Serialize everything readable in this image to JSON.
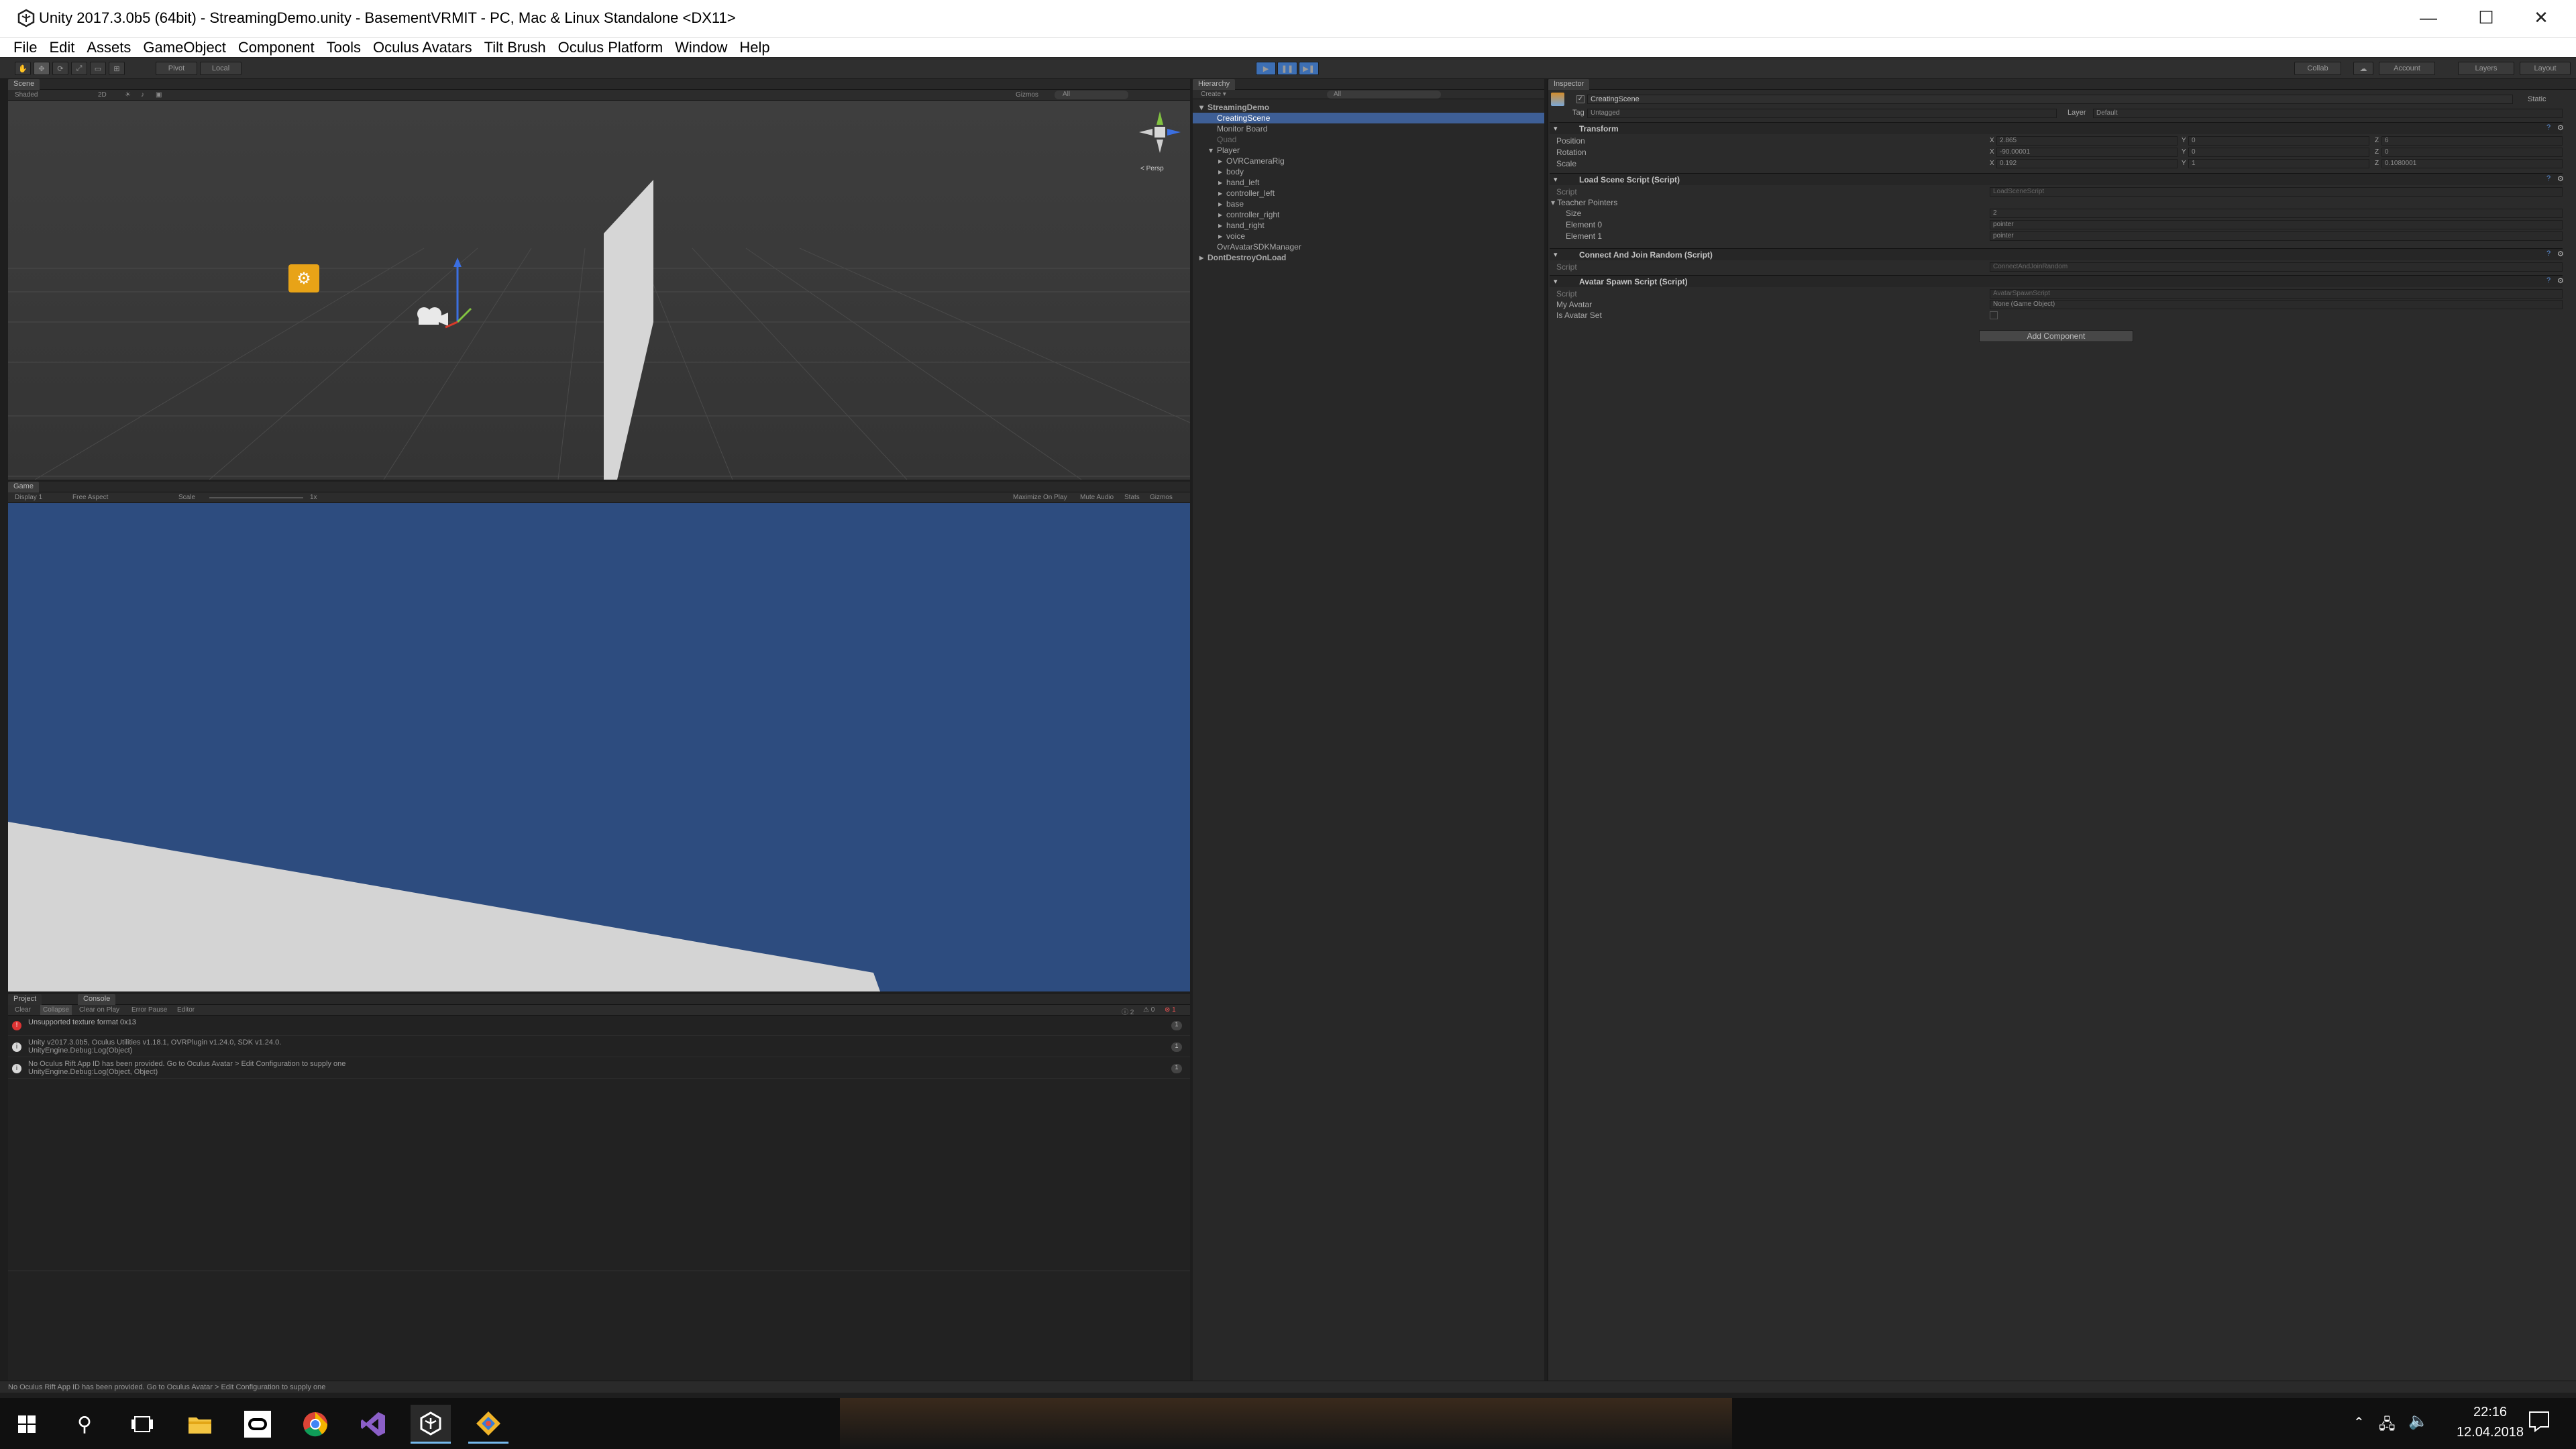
{
  "window": {
    "title": "Unity 2017.3.0b5 (64bit) - StreamingDemo.unity - BasementVRMIT - PC, Mac & Linux Standalone <DX11>",
    "minimize": "—",
    "maximize": "☐",
    "close": "✕"
  },
  "menu": [
    "File",
    "Edit",
    "Assets",
    "GameObject",
    "Component",
    "Tools",
    "Oculus Avatars",
    "Tilt Brush",
    "Oculus Platform",
    "Window",
    "Help"
  ],
  "toolbar": {
    "pivot": "Pivot",
    "local": "Local",
    "collab": "Collab",
    "account": "Account",
    "layers": "Layers",
    "layout": "Layout",
    "play_color": "#3d6fb4"
  },
  "scene": {
    "tab": "Scene",
    "shading": "Shaded",
    "mode_2d": "2D",
    "gizmos": "Gizmos",
    "search": "All",
    "persp": "< Persp",
    "background_color": "#3a3a3a"
  },
  "game": {
    "tab": "Game",
    "display": "Display 1",
    "aspect": "Free Aspect",
    "scale_label": "Scale",
    "scale_value": "1x",
    "maximize": "Maximize On Play",
    "mute": "Mute Audio",
    "stats": "Stats",
    "gizmos": "Gizmos",
    "sky_color": "#2d4c7f"
  },
  "console": {
    "tab_project": "Project",
    "tab_console": "Console",
    "buttons": [
      "Clear",
      "Collapse",
      "Clear on Play",
      "Error Pause",
      "Editor"
    ],
    "counts": {
      "info": "2",
      "warn": "0",
      "error": "1"
    },
    "entries": [
      {
        "type": "error",
        "line1": "Unsupported texture format 0x13",
        "line2": ""
      },
      {
        "type": "info",
        "line1": "Unity v2017.3.0b5, Oculus Utilities v1.18.1, OVRPlugin v1.24.0, SDK v1.24.0.",
        "line2": "UnityEngine.Debug:Log(Object)"
      },
      {
        "type": "info",
        "line1": "No Oculus Rift App ID has been provided. Go to Oculus Avatar > Edit Configuration to supply one",
        "line2": "UnityEngine.Debug:Log(Object, Object)"
      }
    ],
    "status": "No Oculus Rift App ID has been provided. Go to Oculus Avatar > Edit Configuration to supply one"
  },
  "hierarchy": {
    "tab": "Hierarchy",
    "create": "Create ▾",
    "search": "All",
    "items": [
      {
        "label": "StreamingDemo",
        "depth": 0,
        "arrow": "▾"
      },
      {
        "label": "CreatingScene",
        "depth": 1,
        "arrow": "",
        "selected": true
      },
      {
        "label": "Monitor Board",
        "depth": 1,
        "arrow": ""
      },
      {
        "label": "Quad",
        "depth": 1,
        "arrow": "",
        "dim": true
      },
      {
        "label": "Player",
        "depth": 1,
        "arrow": "▾"
      },
      {
        "label": "OVRCameraRig",
        "depth": 2,
        "arrow": "▸"
      },
      {
        "label": "body",
        "depth": 2,
        "arrow": "▸"
      },
      {
        "label": "hand_left",
        "depth": 2,
        "arrow": "▸"
      },
      {
        "label": "controller_left",
        "depth": 2,
        "arrow": "▸"
      },
      {
        "label": "base",
        "depth": 2,
        "arrow": "▸"
      },
      {
        "label": "controller_right",
        "depth": 2,
        "arrow": "▸"
      },
      {
        "label": "hand_right",
        "depth": 2,
        "arrow": "▸"
      },
      {
        "label": "voice",
        "depth": 2,
        "arrow": "▸"
      },
      {
        "label": "OvrAvatarSDKManager",
        "depth": 1,
        "arrow": ""
      },
      {
        "label": "DontDestroyOnLoad",
        "depth": 0,
        "arrow": "▸"
      }
    ]
  },
  "inspector": {
    "tab": "Inspector",
    "object_name": "CreatingScene",
    "static": "Static",
    "tag_label": "Tag",
    "tag_value": "Untagged",
    "layer_label": "Layer",
    "layer_value": "Default",
    "transform": {
      "title": "Transform",
      "position": {
        "label": "Position",
        "x": "2.865",
        "y": "0",
        "z": "6"
      },
      "rotation": {
        "label": "Rotation",
        "x": "-90.00001",
        "y": "0",
        "z": "0"
      },
      "scale": {
        "label": "Scale",
        "x": "0.192",
        "y": "1",
        "z": "0.1080001"
      }
    },
    "load_scene": {
      "title": "Load Scene Script (Script)",
      "script_label": "Script",
      "script_value": "LoadSceneScript",
      "teacher_label": "Teacher Pointers",
      "size_label": "Size",
      "size_value": "2",
      "el0_label": "Element 0",
      "el0_value": "pointer",
      "el1_label": "Element 1",
      "el1_value": "pointer"
    },
    "connect": {
      "title": "Connect And Join Random (Script)",
      "script_label": "Script",
      "script_value": "ConnectAndJoinRandom"
    },
    "avatar_spawn": {
      "title": "Avatar Spawn Script (Script)",
      "script_label": "Script",
      "script_value": "AvatarSpawnScript",
      "my_avatar_label": "My Avatar",
      "my_avatar_value": "None (Game Object)",
      "is_avatar_set_label": "Is Avatar Set"
    },
    "add_component": "Add Component"
  },
  "taskbar": {
    "time": "22:16",
    "date": "12.04.2018"
  }
}
